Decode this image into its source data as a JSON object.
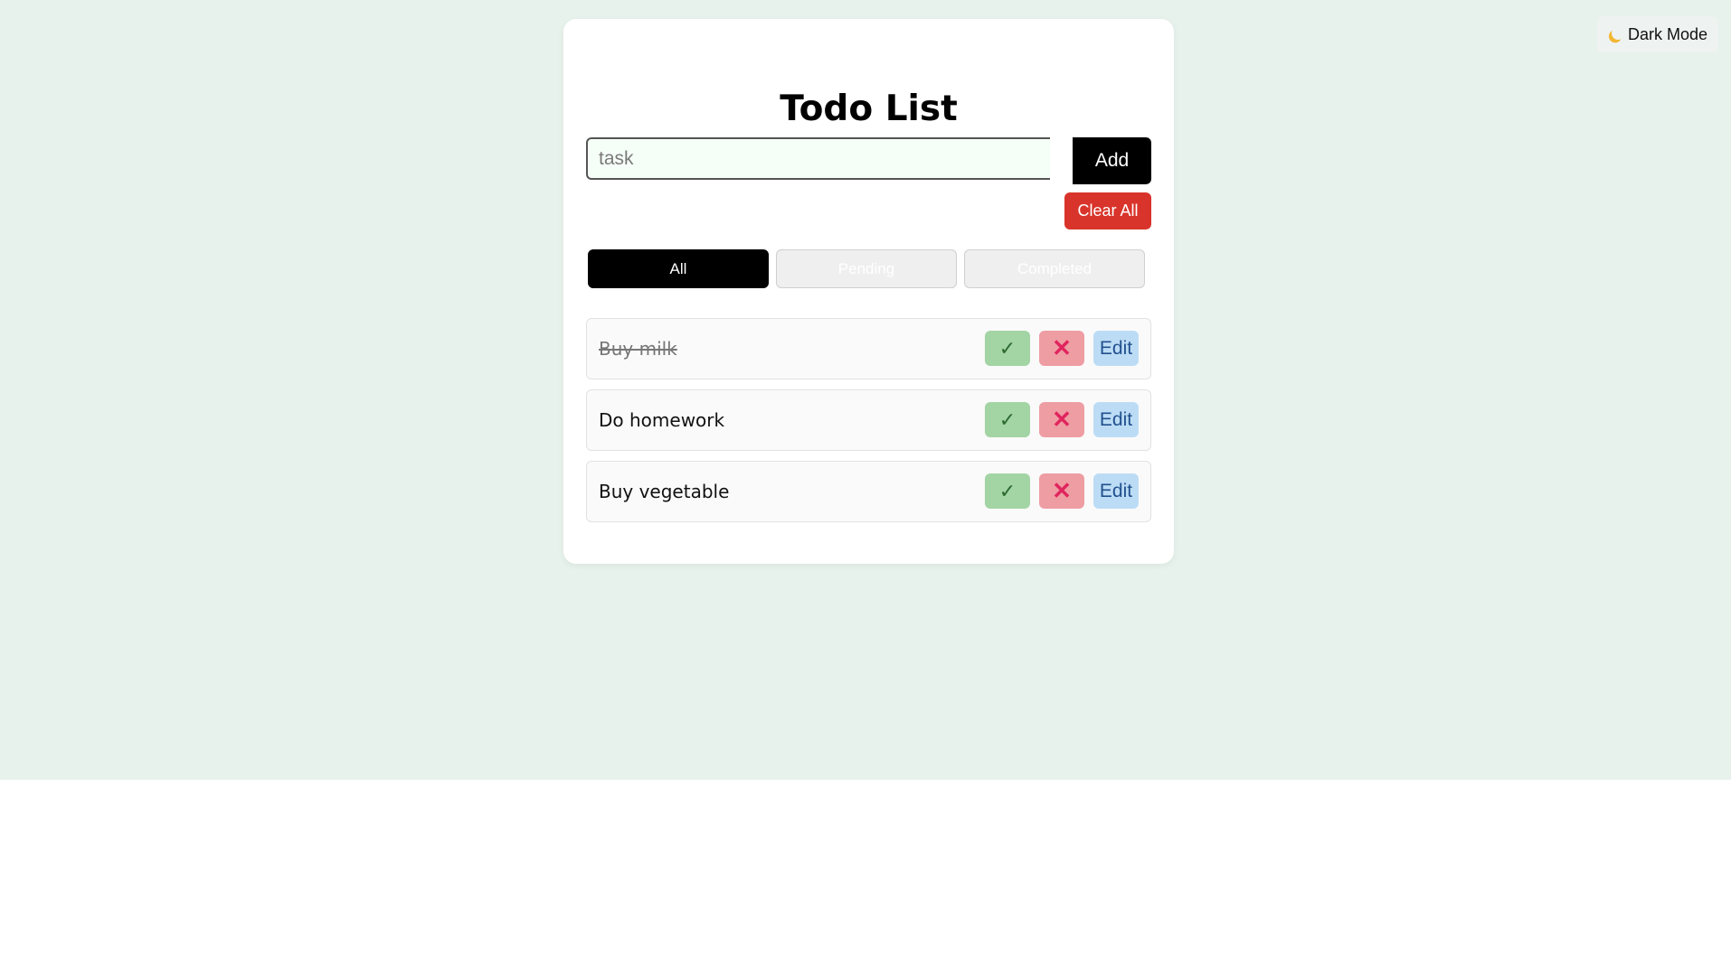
{
  "theme_toggle": {
    "label": "Dark Mode",
    "icon": "moon-icon"
  },
  "app": {
    "title": "Todo List",
    "input": {
      "placeholder": "task",
      "value": ""
    },
    "add_label": "Add",
    "clear_label": "Clear All",
    "filters": [
      {
        "label": "All",
        "active": true
      },
      {
        "label": "Pending",
        "active": false
      },
      {
        "label": "Completed",
        "active": false
      }
    ],
    "todos": [
      {
        "text": "Buy milk",
        "completed": true,
        "edit_label": "Edit"
      },
      {
        "text": "Do homework",
        "completed": false,
        "edit_label": "Edit"
      },
      {
        "text": "Buy vegetable",
        "completed": false,
        "edit_label": "Edit"
      }
    ]
  },
  "icons": {
    "done": "✓",
    "delete": "✕"
  },
  "colors": {
    "page_bg": "#e8f2ed",
    "accent": "#000000",
    "danger": "#d9342b",
    "done_btn": "#a3d4a4",
    "delete_btn": "#ee9da3",
    "edit_btn": "#bcdcf5"
  }
}
